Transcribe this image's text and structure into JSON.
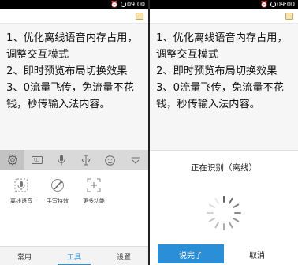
{
  "status": {
    "time": "09:00"
  },
  "editor_lines": [
    "1、优化离线语音内存占用，调整交互模式",
    "2、即时预览布局切换效果",
    "3、0流量飞传，免流量不花钱，秒传输入法内容。"
  ],
  "keyboard": {
    "toolbar_icons": [
      "settings-icon",
      "keyboard-icon",
      "microphone-icon",
      "cursor-icon",
      "emoji-icon",
      "collapse-icon"
    ],
    "functions": [
      {
        "label": "离线语音",
        "icon": "offline-voice-icon"
      },
      {
        "label": "手写特效",
        "icon": "handwriting-icon"
      },
      {
        "label": "更多功能",
        "icon": "more-functions-icon"
      }
    ],
    "page_dots": 4,
    "active_dot": 2,
    "tabs": [
      "常用",
      "工具",
      "设置"
    ],
    "active_tab": 1
  },
  "voice": {
    "title": "正在识别（离线）",
    "done_label": "说完了",
    "cancel_label": "取消"
  },
  "colors": {
    "accent": "#2b8fd8",
    "statusbar": "#000000"
  }
}
